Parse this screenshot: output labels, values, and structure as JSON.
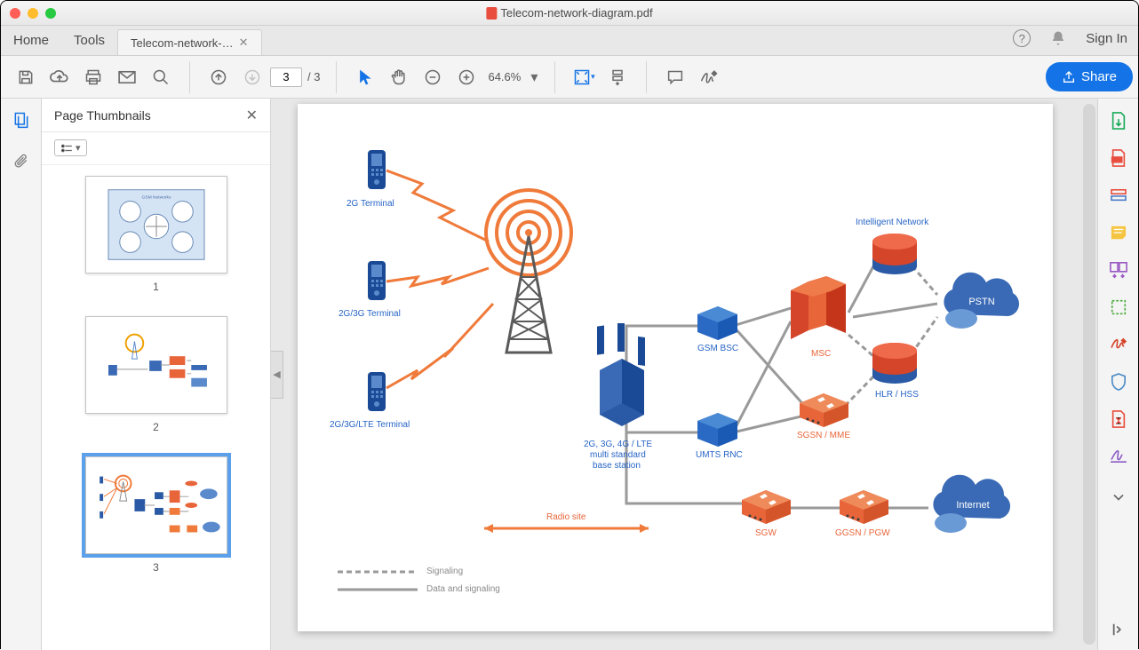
{
  "window": {
    "title": "Telecom-network-diagram.pdf"
  },
  "tabs": {
    "home": "Home",
    "tools": "Tools",
    "doc": "Telecom-network-…",
    "signin": "Sign In"
  },
  "toolbar": {
    "page_current": "3",
    "page_total": "/ 3",
    "zoom": "64.6%",
    "share": "Share"
  },
  "thumbnails": {
    "title": "Page Thumbnails",
    "pages": [
      "1",
      "2",
      "3"
    ]
  },
  "diagram": {
    "labels": {
      "t2g": "2G Terminal",
      "t2g3g": "2G/3G Terminal",
      "t2g3glte": "2G/3G/LTE Terminal",
      "base_l1": "2G, 3G, 4G / LTE",
      "base_l2": "multi standard",
      "base_l3": "base station",
      "radio": "Radio site",
      "gsm": "GSM BSC",
      "umts": "UMTS RNC",
      "msc": "MSC",
      "sgsn": "SGSN / MME",
      "sgw": "SGW",
      "ggsn": "GGSN / PGW",
      "intnet": "Intelligent Network",
      "hlr": "HLR / HSS",
      "pstn": "PSTN",
      "internet": "Internet",
      "legend_sig": "Signaling",
      "legend_data": "Data and signaling"
    }
  }
}
